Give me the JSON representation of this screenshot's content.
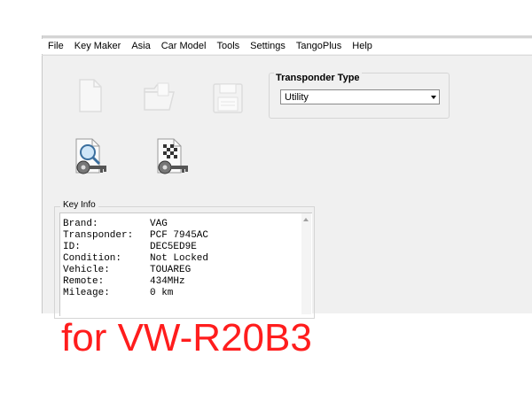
{
  "menu": [
    "File",
    "Key Maker",
    "Asia",
    "Car Model",
    "Tools",
    "Settings",
    "TangoPlus",
    "Help"
  ],
  "transponder": {
    "group_title": "Transponder Type",
    "selected": "Utility"
  },
  "key_info": {
    "title": "Key Info",
    "rows": [
      {
        "label": "Brand:",
        "value": "VAG"
      },
      {
        "label": "Transponder:",
        "value": "PCF 7945AC"
      },
      {
        "label": "ID:",
        "value": "DEC5ED9E"
      },
      {
        "label": "Condition:",
        "value": "Not Locked"
      },
      {
        "label": "Vehicle:",
        "value": "TOUAREG"
      },
      {
        "label": "Remote:",
        "value": "434MHz"
      },
      {
        "label": "Mileage:",
        "value": "0 km"
      }
    ]
  },
  "overlay_text": "for VW-R20B3",
  "colors": {
    "overlay": "#ff1d1d",
    "window_bg": "#f0f0f0"
  }
}
